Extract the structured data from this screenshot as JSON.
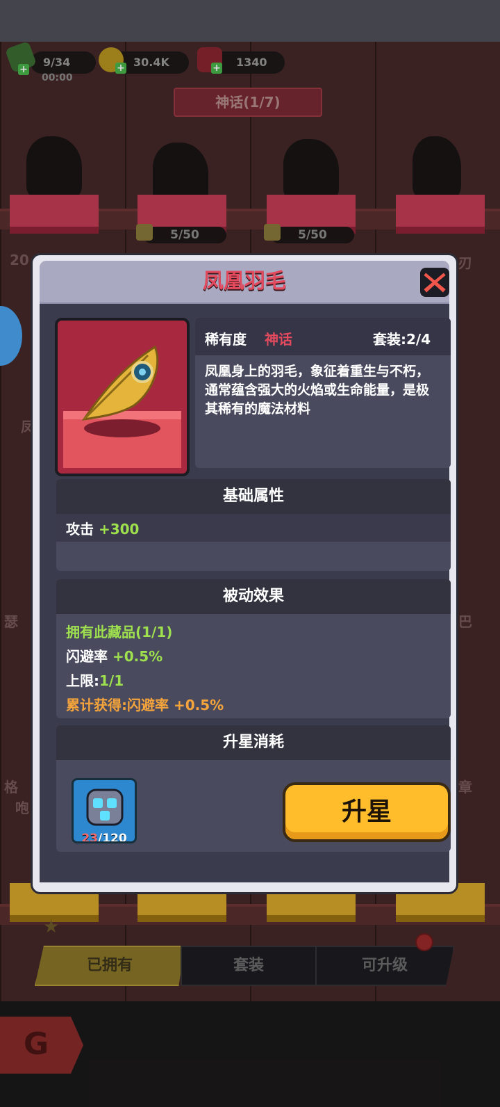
{
  "resources": {
    "energy": "9/34",
    "energy_timer": "00:00",
    "coins": "30.4K",
    "gems": "1340"
  },
  "category_banner": "神话(1/7)",
  "shelf_counters": [
    "5/50",
    "5/50"
  ],
  "side_labels": [
    "20",
    "凤",
    "瑟",
    "格",
    "咆",
    "刃",
    "巴",
    "章"
  ],
  "modal": {
    "title": "凤凰羽毛",
    "rarity_label": "稀有度",
    "rarity_value": "神话",
    "set_label": "套装:2/4",
    "description": "凤凰身上的羽毛，象征着重生与不朽，通常蕴含强大的火焰或生命能量，是极其稀有的魔法材料",
    "base_attr": {
      "title": "基础属性",
      "label": "攻击",
      "value": "+300"
    },
    "passive": {
      "title": "被动效果",
      "owned": "拥有此藏品(1/1)",
      "dodge_label": "闪避率",
      "dodge_value": "+0.5%",
      "cap_label": "上限:",
      "cap_value": "1/1",
      "cumulative": "累计获得:闪避率 +0.5%"
    },
    "upgrade": {
      "title": "升星消耗",
      "material_count": "23",
      "material_total": "/120",
      "button": "升星"
    }
  },
  "tabs": [
    "已拥有",
    "套装",
    "可升级"
  ],
  "colors": {
    "mythic": "#e34a5e",
    "positive": "#9ee04e",
    "cumulative": "#f5a43c",
    "button": "#ffbd2b"
  }
}
